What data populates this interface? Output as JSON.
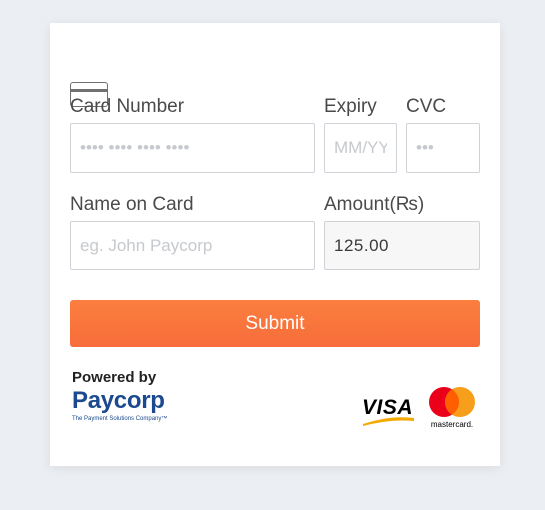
{
  "form": {
    "card_number": {
      "label": "Card Number",
      "placeholder": "•••• •••• •••• ••••"
    },
    "expiry": {
      "label": "Expiry",
      "placeholder": "MM/YY"
    },
    "cvc": {
      "label": "CVC",
      "placeholder": "•••"
    },
    "name_on_card": {
      "label": "Name on Card",
      "placeholder": "eg. John Paycorp"
    },
    "amount": {
      "label": "Amount(₨)",
      "value": "125.00"
    },
    "submit_label": "Submit"
  },
  "footer": {
    "powered_by": "Powered by",
    "brand_name": "Paycorp",
    "brand_tagline": "The Payment Solutions Company™",
    "card_logos": {
      "visa": "VISA",
      "mastercard": "mastercard."
    }
  },
  "icons": {
    "card_icon": "credit-card-icon"
  },
  "colors": {
    "accent": "#f9773d",
    "brand_blue": "#1b4a8f",
    "visa_gold": "#f2a900",
    "mc_red": "#eb001b",
    "mc_orange": "#f79e1b"
  }
}
